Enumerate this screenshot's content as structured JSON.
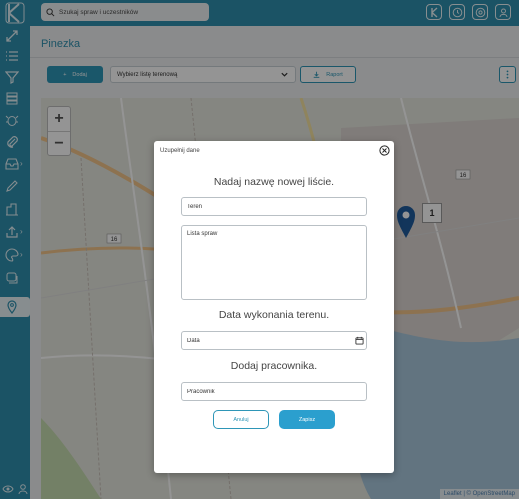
{
  "topbar": {
    "search_placeholder": "Szukaj spraw i uczestników",
    "icons": [
      "logo-k-icon",
      "clock-icon",
      "settings-icon",
      "user-icon"
    ]
  },
  "sidebar": {
    "items": [
      {
        "icon": "expand-icon"
      },
      {
        "icon": "list-icon"
      },
      {
        "icon": "filter-icon"
      },
      {
        "icon": "stack-icon"
      },
      {
        "icon": "bug-icon"
      },
      {
        "icon": "attachment-icon"
      },
      {
        "icon": "inbox-icon",
        "submenu": true
      },
      {
        "icon": "pencil-icon"
      },
      {
        "icon": "building-icon"
      },
      {
        "icon": "upload-icon",
        "submenu": true
      },
      {
        "icon": "palette-icon",
        "submenu": true
      },
      {
        "icon": "chat-icon"
      },
      {
        "icon": "map-pin-icon",
        "active": true
      }
    ],
    "bottom_icons": [
      "eye-icon",
      "person-icon"
    ]
  },
  "page": {
    "title": "Pinezka"
  },
  "toolbar": {
    "add_label": "Dodaj",
    "list_select_value": "Wybierz listę terenową",
    "report_label": "Raport"
  },
  "map": {
    "zoom_in": "+",
    "zoom_out": "−",
    "road_labels": [
      "16",
      "16"
    ],
    "cluster_count": "1",
    "attribution": "Leaflet | © OpenStreetMap"
  },
  "modal": {
    "header": "Uzupełnij dane",
    "list_name_title": "Nadaj nazwę nowej liście.",
    "list_name_value": "Teren",
    "cases_placeholder": "Lista spraw",
    "date_title": "Data wykonania terenu.",
    "date_placeholder": "Data",
    "worker_title": "Dodaj pracownika.",
    "worker_placeholder": "Pracownik",
    "cancel_label": "Anuluj",
    "save_label": "Zapisz"
  },
  "colors": {
    "brand": "#2f8fae",
    "accent": "#2b9fce",
    "pin": "#1f5c9e"
  }
}
